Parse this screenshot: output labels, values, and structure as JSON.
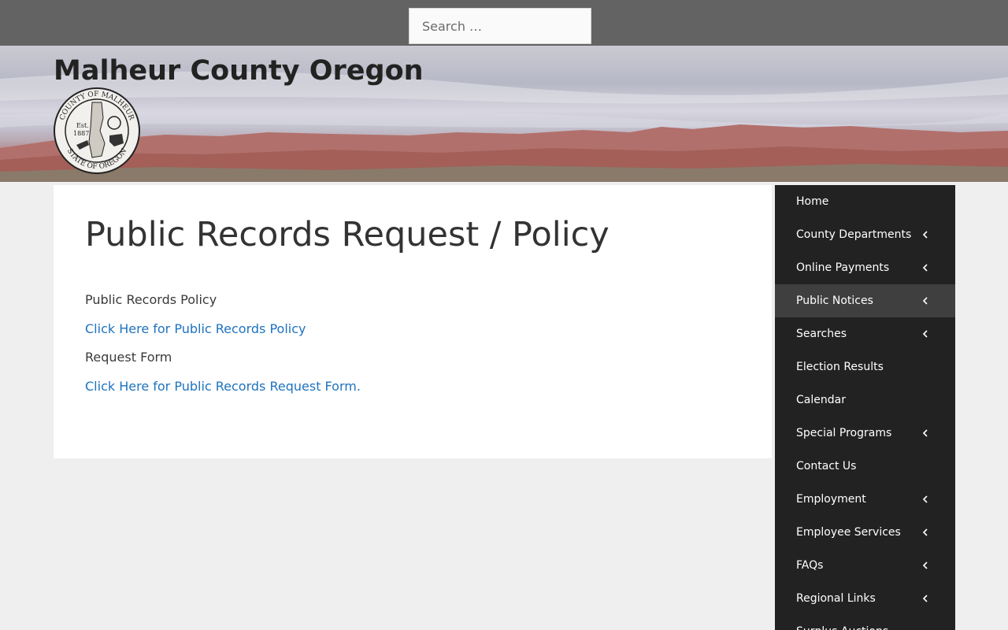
{
  "search": {
    "placeholder": "Search …"
  },
  "site": {
    "title": "Malheur County Oregon",
    "seal": {
      "outer_text_top": "COUNTY OF MALHEUR",
      "outer_text_bottom": "STATE OF OREGON",
      "est_line1": "Est.",
      "est_line2": "1887"
    }
  },
  "page": {
    "title": "Public Records Request / Policy",
    "sections": [
      {
        "heading": "Public Records Policy",
        "link": "Click Here for Public Records Policy"
      },
      {
        "heading": "Request Form",
        "link": "Click Here for Public Records Request Form."
      }
    ]
  },
  "nav": {
    "items": [
      {
        "label": "Home",
        "has_submenu": false,
        "active": false
      },
      {
        "label": "County Departments",
        "has_submenu": true,
        "active": false
      },
      {
        "label": "Online Payments",
        "has_submenu": true,
        "active": false
      },
      {
        "label": "Public Notices",
        "has_submenu": true,
        "active": true
      },
      {
        "label": "Searches",
        "has_submenu": true,
        "active": false
      },
      {
        "label": "Election Results",
        "has_submenu": false,
        "active": false
      },
      {
        "label": "Calendar",
        "has_submenu": false,
        "active": false
      },
      {
        "label": "Special Programs",
        "has_submenu": true,
        "active": false
      },
      {
        "label": "Contact Us",
        "has_submenu": false,
        "active": false
      },
      {
        "label": "Employment",
        "has_submenu": true,
        "active": false
      },
      {
        "label": "Employee Services",
        "has_submenu": true,
        "active": false
      },
      {
        "label": "FAQs",
        "has_submenu": true,
        "active": false
      },
      {
        "label": "Regional Links",
        "has_submenu": true,
        "active": false
      },
      {
        "label": "Surplus Auctions",
        "has_submenu": false,
        "active": false
      }
    ]
  },
  "colors": {
    "topbar": "#636363",
    "sidebar": "#222222",
    "sidebar_active": "#3f3f3f",
    "link": "#1e73be",
    "page_bg": "#efefef"
  }
}
